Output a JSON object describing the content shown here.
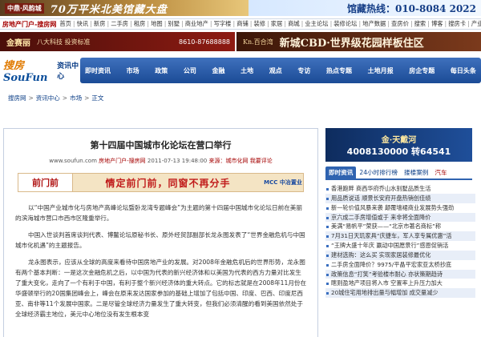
{
  "top_banner": {
    "logo": "中鼎·风韵城",
    "slogan": "70万平米北美馆藏大盘",
    "hotline": "馆藏热线：010-8084 2022"
  },
  "nav": {
    "brand": "房地产门户-搜房网",
    "links": [
      "首页",
      "快讯",
      "新房",
      "二手房",
      "租房",
      "地图",
      "别墅",
      "商业地产",
      "写字楼",
      "商铺",
      "装修",
      "家居",
      "商城",
      "业主论坛",
      "装修论坛",
      "地产数据",
      "查房价",
      "搜索",
      "博客",
      "搜房卡",
      "产业"
    ]
  },
  "ad_row": {
    "left_title": "金赛丽",
    "left_sub": "八大科技 投资标准",
    "left_phone": "8610-87688888",
    "right_title": "Kn.百合湾",
    "right_slogan": "新城CBD·世界级花园样板住区"
  },
  "section": {
    "logo_left": "搜房",
    "logo_brand": "SouFun",
    "logo_suffix": "资讯中心",
    "items": [
      "即时资讯",
      "市场",
      "政策",
      "公司",
      "金融",
      "土地",
      "观点",
      "专访",
      "热点专题",
      "土地月报",
      "房企专题",
      "每日头条"
    ]
  },
  "breadcrumb": [
    "搜房网",
    "资讯中心",
    "市场",
    "正文"
  ],
  "article": {
    "title": "第十四届中国城市化论坛在营口举行",
    "meta_site": "www.soufun.com",
    "meta_source": "房地产门户-搜房网",
    "meta_date": "2011-07-13 19:48:00",
    "meta_origin": "来源：城市化网",
    "meta_comment": "我要评论",
    "ad_logo": "前门前",
    "ad_text": "情定前门前，同窗不再分手",
    "ad_badge": "MCC 中冶置业",
    "paragraphs": [
      "以“中国产业城市化与房地产高峰论坛暨卧龙湾专题峰会”为主题的第十四届中国城市化论坛日前在美丽的滨海城市营口市西市区隆重举行。",
      "中国入世谈判首席谈判代表、博鳌论坛原秘书长、原外经贸部副部长龙永图发表了“世界金融危机与中国城市化机遇”的主题报告。",
      "龙永图表示，应该从全球的高度来看待中国房地产业的发展。对2008年金融危机后的世界形势，龙永图有两个基本判断：一是这次金融危机之后，以中国为代表的新兴经济体和以美国为代表的西方力量对比发生了重大变化，走向了一个有利于中国，有利于整个新兴经济体的重大转点。它的标志就是在2008年11月份在华盛顿举行的20国集团峰会上，峰会在原来发达国家参加的基础上增加了包括中国、印度、巴西、印度尼西亚、南非等11个发展中国家。二是尽管全球经济力量发生了重大转变，但我们必须清醒的看到美国依然处于全球经济霸主地位，美元中心地位没有发生根本变"
    ]
  },
  "right_ad": {
    "line1": "金·天戴河",
    "line2": "4008130000 转64541"
  },
  "tabs": [
    "即时资讯",
    "24小时排行榜",
    "搂楼案例",
    "汽车"
  ],
  "news": [
    "香港跑畔 商西华府乔山水别墅品质生活",
    "用品质说话 顺景长安府开盘热销创佳绩",
    "新一轮价值风暴来袭 颠覆墙裙商业发展势头强劲",
    "京六成二手房增值或于 来非将全面降价",
    "美满“易帆平”荣获——“北京市著名商标”称",
    "7月31日天玑家具“庆捷车，军人享专属优惠”活",
    "“王牌大盛十年庆 赢动中国愿景行”感恩促销活",
    "建材选购：这么买 实现家居装修最优化",
    "二手房全面降价？9975/平晶平宏家亚太桥抄底",
    "政策信息“打笑”考验楼市耐心 亦状策期趋诗",
    "瞎则盈地产项目将入市 空置率上升压力加大",
    "20城住宅用地排出量与幅增加 成交量减少"
  ],
  "colors": {
    "brand_blue": "#1b4b96",
    "accent_red": "#a40000"
  }
}
